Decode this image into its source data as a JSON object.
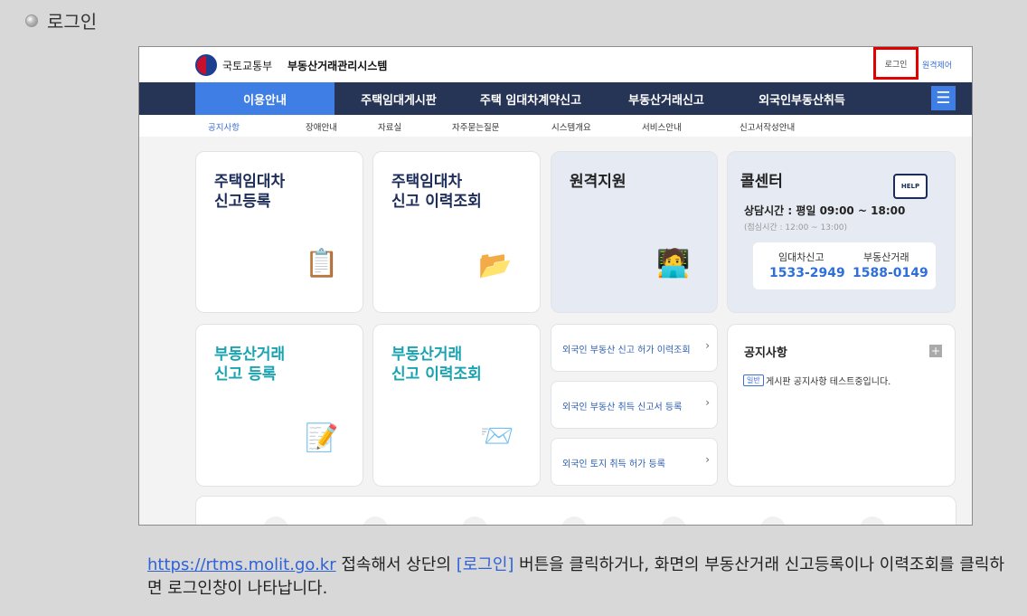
{
  "section": {
    "title": "로그인"
  },
  "site": {
    "ministry": "국토교통부",
    "system_name": "부동산거래관리시스템",
    "login": "로그인",
    "remote": "원격제어"
  },
  "gnb": [
    "이용안내",
    "주택임대게시판",
    "주택 임대차계약신고",
    "부동산거래신고",
    "외국인부동산취득"
  ],
  "subnav": [
    "공지사항",
    "장애안내",
    "자료실",
    "자주묻는질문",
    "시스템개요",
    "서비스안내",
    "신고서작성안내"
  ],
  "cards": {
    "lease_register": {
      "line1": "주택임대차",
      "line2": "신고등록"
    },
    "lease_history": {
      "line1": "주택임대차",
      "line2": "신고 이력조회"
    },
    "remote_support": {
      "title": "원격지원"
    },
    "callcenter": {
      "title": "콜센터",
      "help": "HELP",
      "hours": "상담시간 : 평일 09:00 ~ 18:00",
      "lunch": "(점심시간 : 12:00 ~ 13:00)",
      "lease_label": "임대차신고",
      "lease_phone": "1533-2949",
      "re_label": "부동산거래",
      "re_phone": "1588-0149"
    },
    "re_register": {
      "line1": "부동산거래",
      "line2": "신고 등록"
    },
    "re_history": {
      "line1": "부동산거래",
      "line2": "신고 이력조회"
    }
  },
  "links": [
    {
      "label": "외국인 부동산 신고 허가 이력조회",
      "arrow": "›"
    },
    {
      "label": "외국인 부동산 취득 신고서 등록",
      "arrow": "›"
    },
    {
      "label": "외국인 토지 취득 허가 등록",
      "arrow": "›"
    }
  ],
  "notice": {
    "title": "공지사항",
    "more": "+",
    "badge": "일반",
    "item": "게시판 공지사항 테스트중입니다."
  },
  "caption": {
    "url": "https://rtms.molit.go.kr",
    "text1": " 접속해서 상단의 ",
    "highlight": "[로그인]",
    "text2": " 버튼을 클릭하거나, 화면의 부동산거래 신고등록이나 이력조회를 클릭하면 로그인창이 나타납니다."
  }
}
